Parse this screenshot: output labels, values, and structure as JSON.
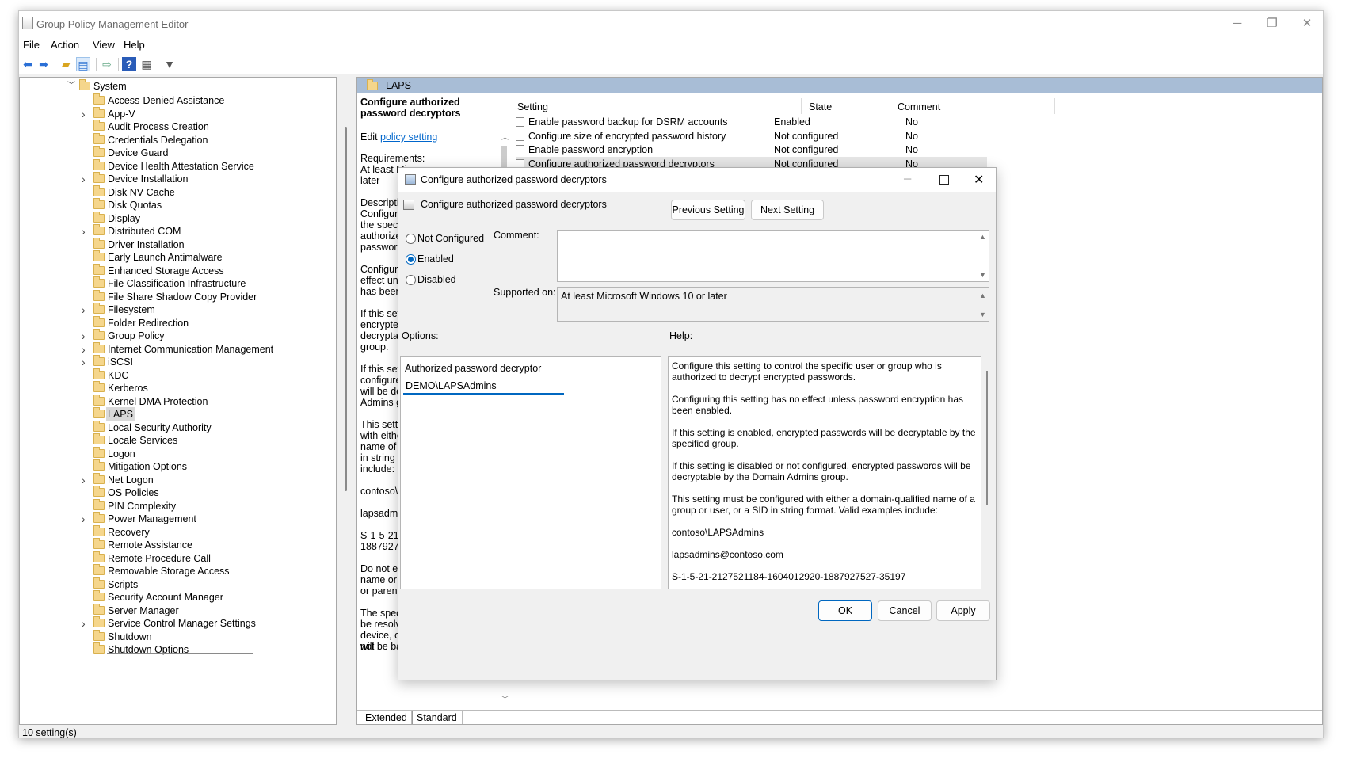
{
  "window": {
    "title": "Group Policy Management Editor",
    "controls": {
      "minimize": "─",
      "restore": "❐",
      "close": "✕"
    }
  },
  "menu": [
    "File",
    "Action",
    "View",
    "Help"
  ],
  "tree": {
    "root": "System",
    "items": [
      {
        "label": "Access-Denied Assistance",
        "expandable": false
      },
      {
        "label": "App-V",
        "expandable": true
      },
      {
        "label": "Audit Process Creation",
        "expandable": false
      },
      {
        "label": "Credentials Delegation",
        "expandable": false
      },
      {
        "label": "Device Guard",
        "expandable": false
      },
      {
        "label": "Device Health Attestation Service",
        "expandable": false
      },
      {
        "label": "Device Installation",
        "expandable": true
      },
      {
        "label": "Disk NV Cache",
        "expandable": false
      },
      {
        "label": "Disk Quotas",
        "expandable": false
      },
      {
        "label": "Display",
        "expandable": false
      },
      {
        "label": "Distributed COM",
        "expandable": true
      },
      {
        "label": "Driver Installation",
        "expandable": false
      },
      {
        "label": "Early Launch Antimalware",
        "expandable": false
      },
      {
        "label": "Enhanced Storage Access",
        "expandable": false
      },
      {
        "label": "File Classification Infrastructure",
        "expandable": false
      },
      {
        "label": "File Share Shadow Copy Provider",
        "expandable": false
      },
      {
        "label": "Filesystem",
        "expandable": true
      },
      {
        "label": "Folder Redirection",
        "expandable": false
      },
      {
        "label": "Group Policy",
        "expandable": true
      },
      {
        "label": "Internet Communication Management",
        "expandable": true
      },
      {
        "label": "iSCSI",
        "expandable": true
      },
      {
        "label": "KDC",
        "expandable": false
      },
      {
        "label": "Kerberos",
        "expandable": false
      },
      {
        "label": "Kernel DMA Protection",
        "expandable": false
      },
      {
        "label": "LAPS",
        "expandable": false,
        "selected": true
      },
      {
        "label": "Local Security Authority",
        "expandable": false
      },
      {
        "label": "Locale Services",
        "expandable": false
      },
      {
        "label": "Logon",
        "expandable": false
      },
      {
        "label": "Mitigation Options",
        "expandable": false
      },
      {
        "label": "Net Logon",
        "expandable": true
      },
      {
        "label": "OS Policies",
        "expandable": false
      },
      {
        "label": "PIN Complexity",
        "expandable": false
      },
      {
        "label": "Power Management",
        "expandable": true
      },
      {
        "label": "Recovery",
        "expandable": false
      },
      {
        "label": "Remote Assistance",
        "expandable": false
      },
      {
        "label": "Remote Procedure Call",
        "expandable": false
      },
      {
        "label": "Removable Storage Access",
        "expandable": false
      },
      {
        "label": "Scripts",
        "expandable": false
      },
      {
        "label": "Security Account Manager",
        "expandable": false
      },
      {
        "label": "Server Manager",
        "expandable": false
      },
      {
        "label": "Service Control Manager Settings",
        "expandable": true
      },
      {
        "label": "Shutdown",
        "expandable": false
      },
      {
        "label": "Shutdown Options",
        "expandable": false
      }
    ]
  },
  "pane": {
    "folder": "LAPS",
    "desc_title": "Configure authorized password decryptors",
    "edit_prefix": "Edit ",
    "edit_link": "policy setting",
    "desc_lines": [
      "Requirements:",
      "At least Micro",
      "later",
      "",
      "Description:",
      "Configure thi",
      "the specific u",
      "authorized to",
      "passwords.",
      "",
      "Configuring t",
      "effect unless",
      "has been enal",
      "",
      "If this setting",
      "encrypted pas",
      "decryptable b",
      "group.",
      "",
      "If this setting",
      "configured, e",
      "will be decryp",
      "Admins group",
      "",
      "This setting m",
      "with either a c",
      "name of a grc",
      "in string form",
      "include:",
      "",
      "contoso\\LAPS",
      "",
      "lapsadmins@",
      "",
      "S-1-5-21-2127",
      "1887927527-3",
      "",
      "Do not enclos",
      "name or SID i",
      "or parenthese",
      "",
      "The specified",
      "be resolvable",
      "device, otherwise passwords will",
      "not be backed up."
    ],
    "columns": [
      "Setting",
      "State",
      "Comment"
    ],
    "rows": [
      {
        "setting": "Enable password backup for DSRM accounts",
        "state": "Enabled",
        "comment": "No"
      },
      {
        "setting": "Configure size of encrypted password history",
        "state": "Not configured",
        "comment": "No"
      },
      {
        "setting": "Enable password encryption",
        "state": "Not configured",
        "comment": "No"
      },
      {
        "setting": "Configure authorized password decryptors",
        "state": "Not configured",
        "comment": "No"
      }
    ],
    "tabs": [
      "Extended",
      "Standard"
    ]
  },
  "status": "10 setting(s)",
  "dialog": {
    "title": "Configure authorized password decryptors",
    "heading": "Configure authorized password decryptors",
    "prev_button": "Previous Setting",
    "next_button": "Next Setting",
    "radios": {
      "not_configured": "Not Configured",
      "enabled": "Enabled",
      "disabled": "Disabled"
    },
    "comment_label": "Comment:",
    "supported_label": "Supported on:",
    "supported_value": "At least Microsoft Windows 10 or later",
    "options_label": "Options:",
    "help_label": "Help:",
    "option_field_label": "Authorized password decryptor",
    "option_field_value": "DEMO\\LAPSAdmins",
    "help_paragraphs": [
      "Configure this setting to control the specific user or group who is authorized to decrypt encrypted passwords.",
      "Configuring this setting has no effect unless password encryption has been enabled.",
      "If this setting is enabled, encrypted passwords will be decryptable by the specified group.",
      "If this setting is disabled or not configured, encrypted passwords will be decryptable by the Domain Admins group.",
      "This setting must be configured with either a domain-qualified name of a group or user, or a SID in string format. Valid examples include:",
      "contoso\\LAPSAdmins",
      "lapsadmins@contoso.com",
      "S-1-5-21-2127521184-1604012920-1887927527-35197"
    ],
    "ok": "OK",
    "cancel": "Cancel",
    "apply": "Apply"
  },
  "colors": {
    "accent": "#0067c0",
    "header": "#a8bdd6",
    "link": "#0066cc"
  }
}
